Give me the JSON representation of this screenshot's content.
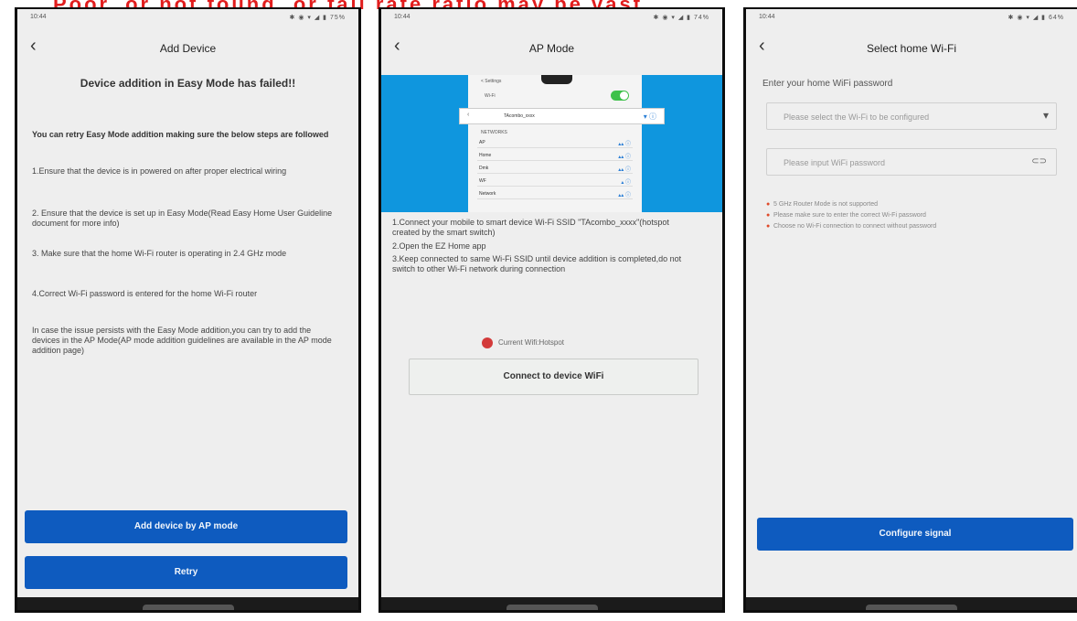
{
  "banner": {
    "text": "Poor, or not found, or fail rate ratio may be vast"
  },
  "phone1": {
    "status": {
      "time": "10:44",
      "icons": "✱ ◉ ▾ ◢ ▮ 75%"
    },
    "title": "Add Device",
    "headline": "Device addition in Easy Mode has failed!!",
    "intro": "You can retry Easy Mode addition making sure the below steps are followed",
    "steps": [
      "1.Ensure that the device is in powered on after proper electrical wiring",
      "2. Ensure that the device is set up in Easy Mode(Read Easy Home User Guideline document for more info)",
      "3. Make sure that the home Wi-Fi router is operating in 2.4 GHz mode",
      "4.Correct Wi-Fi password is entered for the home Wi-Fi router"
    ],
    "note": "In case the issue persists with the Easy Mode addition,you can try to add the devices in the AP Mode(AP mode addition guidelines are available in the AP mode addition page)",
    "btn_ap": "Add device by AP mode",
    "btn_retry": "Retry"
  },
  "phone2": {
    "status": {
      "time": "10:44",
      "icons": "✱ ◉ ▾ ◢ ▮ 74%"
    },
    "title": "AP Mode",
    "mock": {
      "header": "< Settings",
      "wlan": "Wi-Fi",
      "selected_ssid": "TAcombo_xxxx",
      "section": "NETWORKS",
      "networks": [
        "AP",
        "Home",
        "Dmk",
        "WF",
        "Network"
      ]
    },
    "steps": [
      "1.Connect your mobile to smart device Wi-Fi SSID \"TAcombo_xxxx\"(hotspot created by the smart switch)",
      "2.Open the EZ Home app",
      "3.Keep connected to same Wi-Fi SSID until device addition is completed,do not switch to other Wi-Fi network during connection"
    ],
    "check_label": "Current Wifi:Hotspot",
    "btn_connect": "Connect to device WiFi"
  },
  "phone3": {
    "status": {
      "time": "10:44",
      "icons": "✱ ◉ ▾ ◢ ▮ 64%"
    },
    "title": "Select home Wi-Fi",
    "prompt": "Enter your home WiFi password",
    "ssid_placeholder": "Please select the Wi-Fi to be configured",
    "pwd_placeholder": "Please input WiFi password",
    "bullets": [
      "5 GHz Router Mode is not supported",
      "Please make sure to enter the correct Wi-Fi password",
      "Choose no Wi-Fi connection to connect without password"
    ],
    "btn_configure": "Configure signal"
  },
  "colors": {
    "primary": "#0e5bbf",
    "banner": "#e11d1d",
    "ap_blue": "#0f96de"
  }
}
